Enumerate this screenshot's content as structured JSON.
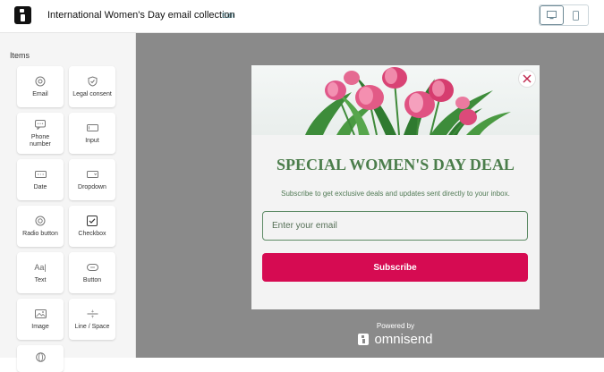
{
  "header": {
    "title": "International Women's Day email collection",
    "edit_label": "Edit",
    "devices": [
      "desktop-icon",
      "mobile-icon"
    ]
  },
  "sidebar": {
    "heading": "Items",
    "items": [
      {
        "label": "Email",
        "icon": "at-icon"
      },
      {
        "label": "Legal consent",
        "icon": "shield-check-icon"
      },
      {
        "label": "Phone number",
        "icon": "phone-chat-icon"
      },
      {
        "label": "Input",
        "icon": "input-icon"
      },
      {
        "label": "Date",
        "icon": "date-icon"
      },
      {
        "label": "Dropdown",
        "icon": "dropdown-icon"
      },
      {
        "label": "Radio button",
        "icon": "radio-icon"
      },
      {
        "label": "Checkbox",
        "icon": "checkbox-icon"
      },
      {
        "label": "Text",
        "icon": "text-icon"
      },
      {
        "label": "Button",
        "icon": "button-icon"
      },
      {
        "label": "Image",
        "icon": "image-icon"
      },
      {
        "label": "Line / Space",
        "icon": "line-space-icon"
      }
    ]
  },
  "popup": {
    "headline": "SPECIAL WOMEN'S DAY DEAL",
    "subtext": "Subscribe to get exclusive deals and updates sent directly to your inbox.",
    "email_placeholder": "Enter your email",
    "button_label": "Subscribe",
    "button_color": "#d60b52",
    "headline_color": "#4b7d4b"
  },
  "footer": {
    "powered_by": "Powered by",
    "brand": "omnisend"
  }
}
